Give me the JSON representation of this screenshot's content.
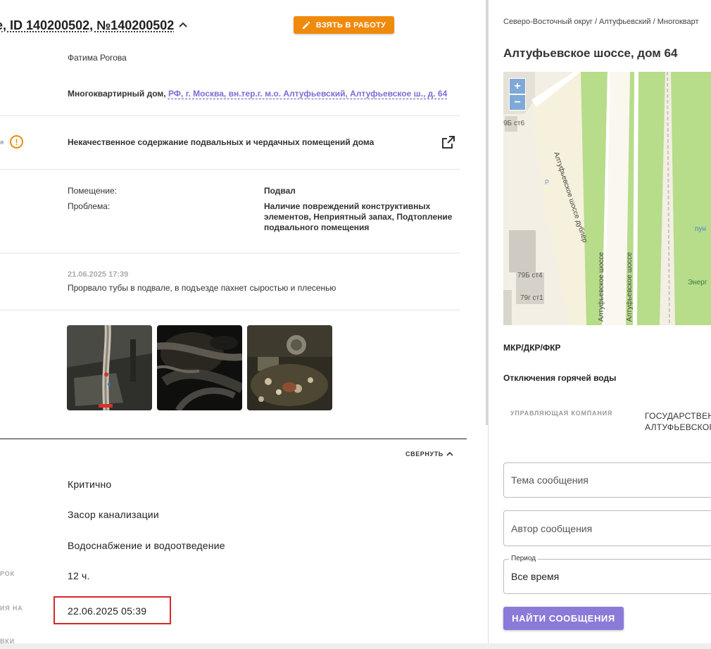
{
  "request": {
    "title": "е, ID 140200502, №140200502",
    "take_button": "ВЗЯТЬ В РАБОТУ",
    "applicant": "Фатима Рогова",
    "object_type": "Многоквартирный дом,",
    "object_address": "РФ, г. Москва, вн.тер.г. м.о. Алтуфьевский, Алтуфьевское ш., д. 64",
    "problem_cut_label": "я",
    "problem_title": "Некачественное содержание подвальных и чердачных помещений дома",
    "details": [
      {
        "label": "Помещение:",
        "value": "Подвал"
      },
      {
        "label": "Проблема:",
        "value_lines": [
          "Наличие повреждений конструктивных",
          "элементов, Неприятный запах, Подтопление",
          "подвального помещения"
        ]
      }
    ],
    "comment_time": "21.06.2025 17:39",
    "comment_text": "Прорвало тубы в подвале, в подъезде пахнет сыростью и плесенью",
    "collapse_label": "СВЕРНУТЬ",
    "fields": [
      {
        "label": "",
        "value": "Критично"
      },
      {
        "label": "",
        "value": "Засор канализации"
      },
      {
        "label": "",
        "value": "Водоснабжение и водоотведение"
      },
      {
        "label": "РОК",
        "value": "12 ч."
      },
      {
        "label": "ИЯ НА",
        "value": "22.06.2025 05:39"
      }
    ],
    "bottom_cut_label": "ВКИ"
  },
  "right": {
    "breadcrumb": "Северо-Восточный округ / Алтуфьевский / Многокварт",
    "address_title": "Алтуфьевское шоссе, дом 64",
    "map": {
      "zoom_in": "+",
      "zoom_out": "−",
      "labels": [
        "9Б ст6",
        "79Б ст4",
        "79г ст1",
        "Алтуфьевское шоссе дублёр",
        "Алтуфьевское шоссе",
        "Алтуфьевское шоссе",
        "пун",
        "Энерг",
        "P"
      ]
    },
    "section_mkr": "МКР/ДКР/ФКР",
    "section_hot_water": "Отключения горячей воды",
    "mc_label": "УПРАВЛЯЮЩАЯ КОМПАНИЯ",
    "mc_value_lines": [
      "ГОСУДАРСТВЕН",
      "АЛТУФЬЕВСКОГ"
    ],
    "subject_placeholder": "Тема сообщения",
    "author_placeholder": "Автор сообщения",
    "period_label": "Период",
    "period_value": "Все время",
    "find_button": "НАЙТИ СООБЩЕНИЯ"
  },
  "colors": {
    "accent_orange": "#f08a0c",
    "accent_purple": "#8b7ad8",
    "link_purple": "#7e6bd2",
    "highlight_red": "#d62828"
  }
}
